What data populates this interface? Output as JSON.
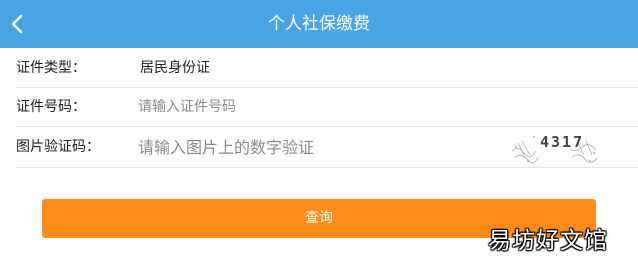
{
  "header": {
    "title": "个人社保缴费"
  },
  "form": {
    "id_type": {
      "label": "证件类型：",
      "value": "居民身份证"
    },
    "id_number": {
      "label": "证件号码：",
      "placeholder": "请输入证件号码"
    },
    "captcha": {
      "label": "图片验证码：",
      "placeholder": "请输入图片上的数字验证",
      "code": "4317"
    }
  },
  "query_button": {
    "label": "查询"
  },
  "watermark": "易坊好文馆",
  "colors": {
    "header": "#4aa3e3",
    "button": "#ff8b1a"
  },
  "icons": {
    "back": "chevron-left-icon"
  }
}
